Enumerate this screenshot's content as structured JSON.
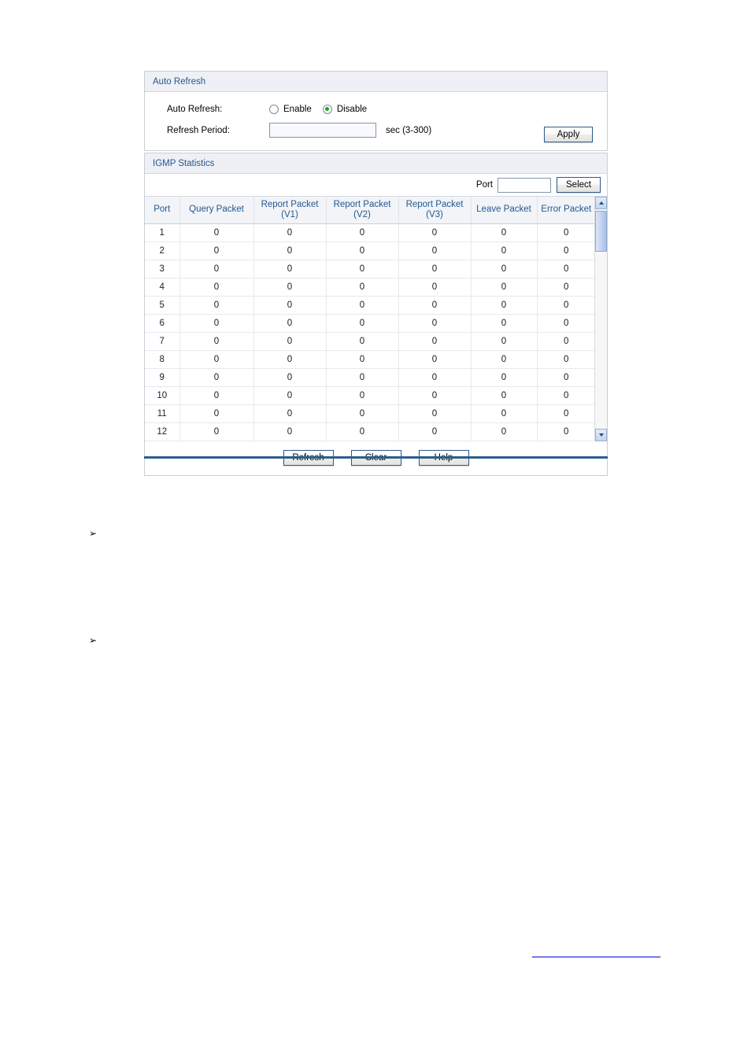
{
  "auto_refresh_panel": {
    "title": "Auto Refresh",
    "auto_refresh_label": "Auto Refresh:",
    "options": [
      {
        "label": "Enable",
        "selected": false
      },
      {
        "label": "Disable",
        "selected": true
      }
    ],
    "refresh_period_label": "Refresh Period:",
    "refresh_period_value": "",
    "refresh_period_unit": "sec (3-300)",
    "apply_label": "Apply"
  },
  "igmp_panel": {
    "title": "IGMP Statistics",
    "port_filter_label": "Port",
    "port_filter_value": "",
    "select_label": "Select",
    "columns": [
      "Port",
      "Query Packet",
      "Report Packet (V1)",
      "Report Packet (V2)",
      "Report Packet (V3)",
      "Leave Packet",
      "Error Packet"
    ],
    "column_lines": [
      [
        "Port"
      ],
      [
        "Query Packet"
      ],
      [
        "Report Packet",
        "(V1)"
      ],
      [
        "Report Packet",
        "(V2)"
      ],
      [
        "Report Packet",
        "(V3)"
      ],
      [
        "Leave Packet"
      ],
      [
        "Error Packet"
      ]
    ],
    "rows": [
      [
        "1",
        "0",
        "0",
        "0",
        "0",
        "0",
        "0"
      ],
      [
        "2",
        "0",
        "0",
        "0",
        "0",
        "0",
        "0"
      ],
      [
        "3",
        "0",
        "0",
        "0",
        "0",
        "0",
        "0"
      ],
      [
        "4",
        "0",
        "0",
        "0",
        "0",
        "0",
        "0"
      ],
      [
        "5",
        "0",
        "0",
        "0",
        "0",
        "0",
        "0"
      ],
      [
        "6",
        "0",
        "0",
        "0",
        "0",
        "0",
        "0"
      ],
      [
        "7",
        "0",
        "0",
        "0",
        "0",
        "0",
        "0"
      ],
      [
        "8",
        "0",
        "0",
        "0",
        "0",
        "0",
        "0"
      ],
      [
        "9",
        "0",
        "0",
        "0",
        "0",
        "0",
        "0"
      ],
      [
        "10",
        "0",
        "0",
        "0",
        "0",
        "0",
        "0"
      ],
      [
        "11",
        "0",
        "0",
        "0",
        "0",
        "0",
        "0"
      ],
      [
        "12",
        "0",
        "0",
        "0",
        "0",
        "0",
        "0"
      ]
    ],
    "action_buttons": [
      "Refresh",
      "Clear",
      "Help"
    ]
  },
  "body": {
    "bullet_glyph": "➢",
    "bullet_items": [
      "",
      ""
    ],
    "footer_link_text": ""
  },
  "colors": {
    "panel_title_text": "#24588f",
    "table_header_text": "#24588f",
    "divider": "#2b5f8e",
    "radio_selected": "#19a519",
    "link": "#0000cc"
  }
}
